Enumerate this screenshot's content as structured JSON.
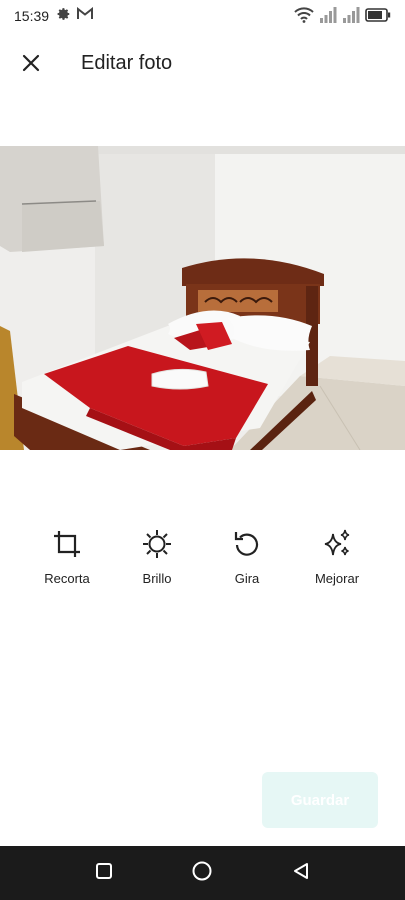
{
  "status_bar": {
    "time": "15:39",
    "left_icons": [
      "gear-icon",
      "gmail-icon"
    ],
    "right_icons": [
      "wifi-icon",
      "signal-icon",
      "signal-icon",
      "battery-icon"
    ]
  },
  "header": {
    "close_icon": "close-icon",
    "title": "Editar foto"
  },
  "photo": {
    "subject": "bedroom-photo"
  },
  "tools": [
    {
      "label": "Recorta",
      "icon": "crop-icon"
    },
    {
      "label": "Brillo",
      "icon": "brightness-icon"
    },
    {
      "label": "Gira",
      "icon": "rotate-icon"
    },
    {
      "label": "Mejorar",
      "icon": "sparkle-icon"
    }
  ],
  "save_button": {
    "label": "Guardar"
  },
  "nav_bar": {
    "buttons": [
      "recent-apps-icon",
      "home-icon",
      "back-icon"
    ]
  },
  "colors": {
    "save_button_bg": "#e6f7f5",
    "nav_bar_bg": "#1b1b1b",
    "bedspread_red": "#c8161d"
  }
}
